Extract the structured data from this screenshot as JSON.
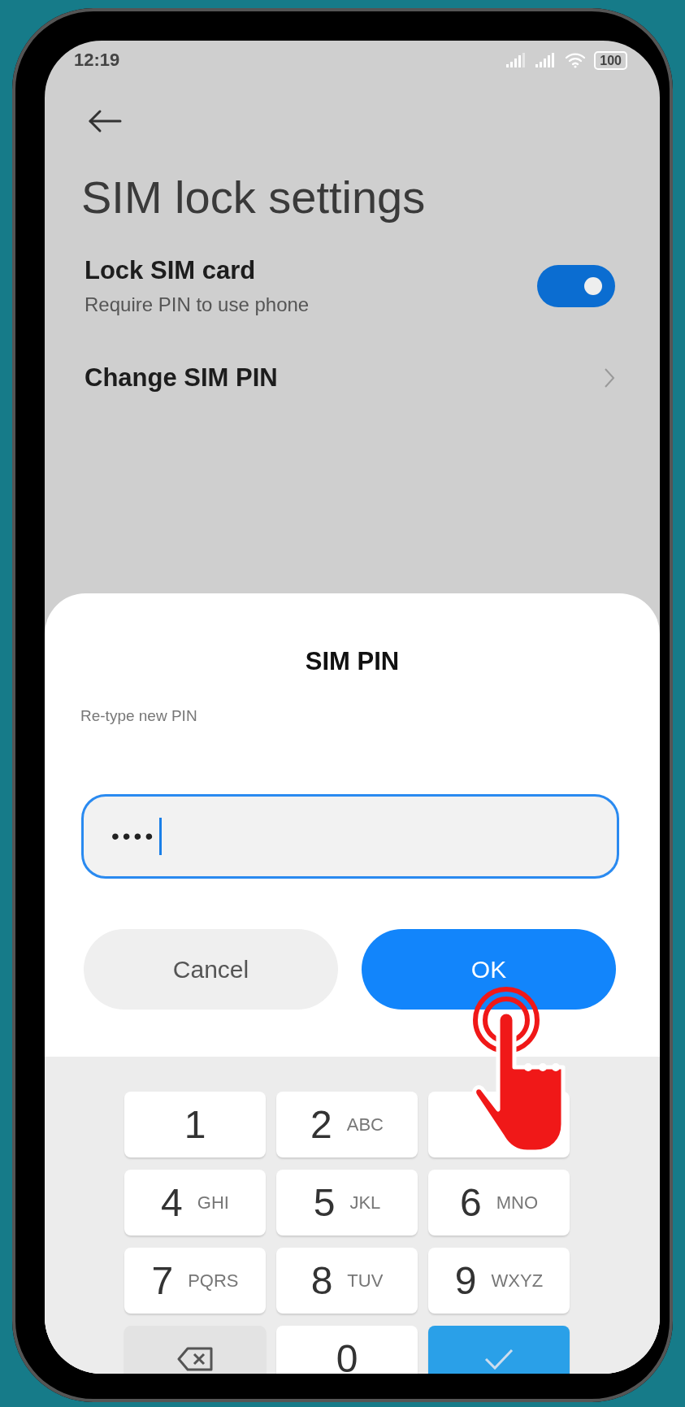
{
  "status_bar": {
    "time": "12:19",
    "battery": "100"
  },
  "header": {
    "title": "SIM lock settings"
  },
  "settings": [
    {
      "kind": "toggle",
      "title": "Lock SIM card",
      "subtitle": "Require PIN to use phone",
      "on": true
    },
    {
      "kind": "link",
      "title": "Change SIM PIN"
    }
  ],
  "dialog": {
    "title": "SIM PIN",
    "prompt": "Re-type new PIN",
    "field": {
      "value": "••••"
    },
    "buttons": [
      {
        "kind": "secondary",
        "label": "Cancel"
      },
      {
        "kind": "primary",
        "label": "OK"
      }
    ]
  },
  "keypad": [
    {
      "kind": "digit",
      "digit": "1"
    },
    {
      "kind": "digit",
      "digit": "2",
      "letters": "ABC"
    },
    {
      "kind": "digit"
    },
    {
      "kind": "digit",
      "digit": "4",
      "letters": "GHI"
    },
    {
      "kind": "digit",
      "digit": "5",
      "letters": "JKL"
    },
    {
      "kind": "digit",
      "digit": "6",
      "letters": "MNO"
    },
    {
      "kind": "digit",
      "digit": "7",
      "letters": "PQRS"
    },
    {
      "kind": "digit",
      "digit": "8",
      "letters": "TUV"
    },
    {
      "kind": "digit",
      "digit": "9",
      "letters": "WXYZ"
    },
    {
      "kind": "backspace"
    },
    {
      "kind": "digit",
      "digit": "0"
    },
    {
      "kind": "done"
    }
  ]
}
